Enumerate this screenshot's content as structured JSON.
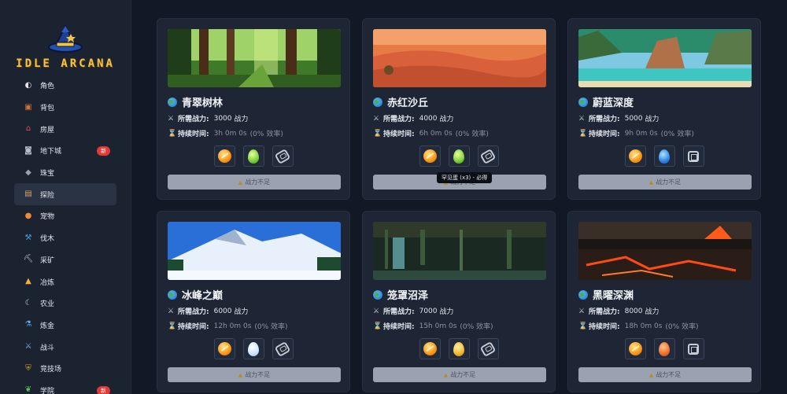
{
  "app": {
    "logo_text": "IDLE ARCANA"
  },
  "sidebar": {
    "items": [
      {
        "label": "角色",
        "icon": "character-icon",
        "active": false,
        "badge": ""
      },
      {
        "label": "背包",
        "icon": "backpack-icon",
        "active": false,
        "badge": ""
      },
      {
        "label": "房屋",
        "icon": "house-icon",
        "active": false,
        "badge": ""
      },
      {
        "label": "地下城",
        "icon": "dungeon-icon",
        "active": false,
        "badge": "新"
      },
      {
        "label": "珠宝",
        "icon": "jewel-icon",
        "active": false,
        "badge": ""
      },
      {
        "label": "探险",
        "icon": "map-icon",
        "active": true,
        "badge": ""
      },
      {
        "label": "宠物",
        "icon": "pet-egg-icon",
        "active": false,
        "badge": ""
      },
      {
        "label": "伐木",
        "icon": "axe-icon",
        "active": false,
        "badge": ""
      },
      {
        "label": "采矿",
        "icon": "pickaxe-icon",
        "active": false,
        "badge": ""
      },
      {
        "label": "冶炼",
        "icon": "anvil-icon",
        "active": false,
        "badge": ""
      },
      {
        "label": "农业",
        "icon": "sickle-icon",
        "active": false,
        "badge": ""
      },
      {
        "label": "炼金",
        "icon": "potion-icon",
        "active": false,
        "badge": ""
      },
      {
        "label": "战斗",
        "icon": "sword-icon",
        "active": false,
        "badge": ""
      },
      {
        "label": "竞技场",
        "icon": "shield-icon",
        "active": false,
        "badge": ""
      },
      {
        "label": "学院",
        "icon": "leaf-icon",
        "active": false,
        "badge": "新"
      }
    ]
  },
  "labels": {
    "power_label": "所需战力:",
    "power_unit": "战力",
    "duration_label": "持续时间:",
    "efficiency": "(0% 效率)",
    "button_label": "战力不足"
  },
  "tooltip": {
    "text": "罕见蛋 (x3) - 必得"
  },
  "cards": [
    {
      "name": "青翠树林",
      "power": "3000",
      "duration": "3h 0m 0s",
      "scene": "forest",
      "rewards": [
        "fire-orb-icon",
        "green-egg-icon",
        "stone-icon"
      ]
    },
    {
      "name": "赤红沙丘",
      "power": "4000",
      "duration": "6h 0m 0s",
      "scene": "desert",
      "rewards": [
        "fire-orb-icon",
        "green-egg-icon",
        "stone-icon"
      ]
    },
    {
      "name": "蔚蓝深度",
      "power": "5000",
      "duration": "9h 0m 0s",
      "scene": "lagoon",
      "rewards": [
        "fire-orb-icon",
        "blue-egg-icon",
        "cube-icon"
      ]
    },
    {
      "name": "冰峰之巅",
      "power": "6000",
      "duration": "12h 0m 0s",
      "scene": "snow",
      "rewards": [
        "fire-orb-icon",
        "white-egg-icon",
        "stone-icon"
      ]
    },
    {
      "name": "笼罩沼泽",
      "power": "7000",
      "duration": "15h 0m 0s",
      "scene": "swamp",
      "rewards": [
        "fire-orb-icon",
        "gold-egg-icon",
        "stone-icon"
      ]
    },
    {
      "name": "黑曜深渊",
      "power": "8000",
      "duration": "18h 0m 0s",
      "scene": "abyss",
      "rewards": [
        "fire-orb-icon",
        "orange-egg-icon",
        "cube-icon"
      ]
    }
  ]
}
